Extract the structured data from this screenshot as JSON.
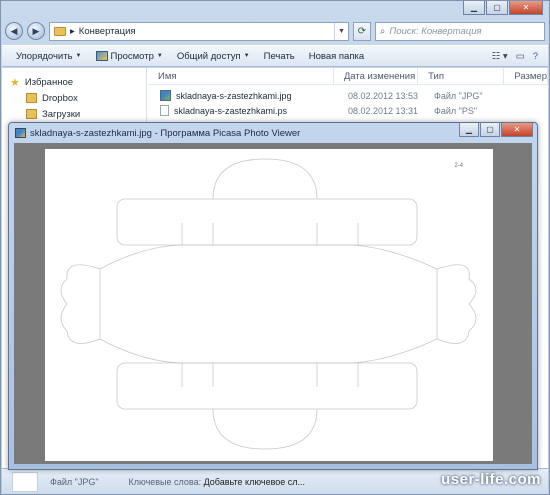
{
  "explorer": {
    "address": "Конвертация",
    "search_placeholder": "Поиск: Конвертация",
    "toolbar": {
      "organize": "Упорядочить",
      "view": "Просмотр",
      "share": "Общий доступ",
      "print": "Печать",
      "new_folder": "Новая папка"
    },
    "sidebar": {
      "favorites": "Избранное",
      "items": [
        "Dropbox",
        "Загрузки"
      ]
    },
    "columns": {
      "name": "Имя",
      "date": "Дата изменения",
      "type": "Тип",
      "size": "Размер"
    },
    "files": [
      {
        "name": "skladnaya-s-zastezhkami.jpg",
        "date": "08.02.2012 13:53",
        "type": "Файл \"JPG\""
      },
      {
        "name": "skladnaya-s-zastezhkami.ps",
        "date": "08.02.2012 13:31",
        "type": "Файл \"PS\""
      }
    ],
    "status": {
      "file_type": "Файл \"JPG\"",
      "keywords_label": "Ключевые слова:",
      "keywords_value": "Добавьте ключевое сл..."
    }
  },
  "picasa": {
    "title": "skladnaya-s-zastezhkami.jpg - Программа Picasa Photo Viewer",
    "page_number": "2-4"
  },
  "watermark": "user-life.com"
}
